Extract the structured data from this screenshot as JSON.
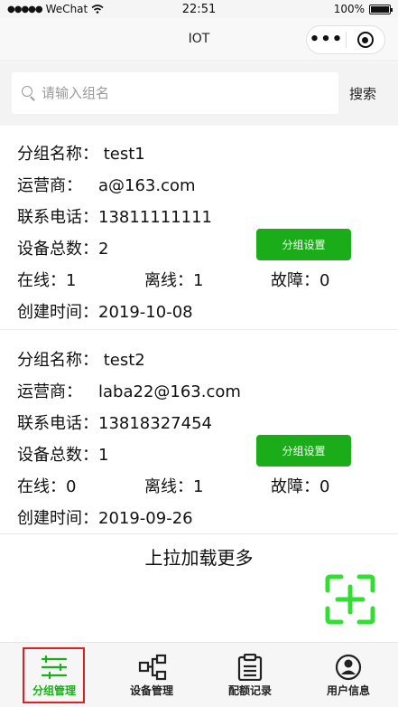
{
  "statusbar": {
    "carrier": "WeChat",
    "time": "22:51",
    "battery": "100%",
    "battery_level": 1.0
  },
  "navbar": {
    "title": "IOT"
  },
  "search": {
    "placeholder": "请输入组名",
    "button_label": "搜索"
  },
  "groups": [
    {
      "name_label": "分组名称：",
      "name": "test1",
      "operator_label": "运营商：",
      "operator": "a@163.com",
      "phone_label": "联系电话：",
      "phone": "13811111111",
      "total_label": "设备总数：",
      "total": "2",
      "online_label": "在线：",
      "online": "1",
      "offline_label": "离线：",
      "offline": "1",
      "fault_label": "故障：",
      "fault": "0",
      "created_label": "创建时间：",
      "created": "2019-10-08",
      "settings_button": "分组设置"
    },
    {
      "name_label": "分组名称：",
      "name": "test2",
      "operator_label": "运营商：",
      "operator": "laba22@163.com",
      "phone_label": "联系电话：",
      "phone": "13818327454",
      "total_label": "设备总数：",
      "total": "1",
      "online_label": "在线：",
      "online": "0",
      "offline_label": "离线：",
      "offline": "1",
      "fault_label": "故障：",
      "fault": "0",
      "created_label": "创建时间：",
      "created": "2019-09-26",
      "settings_button": "分组设置"
    }
  ],
  "load_more": "上拉加载更多",
  "colors": {
    "accent": "#1aad19",
    "fab": "#33dd33",
    "highlight": "#e02020"
  },
  "tabbar": {
    "items": [
      {
        "label": "分组管理",
        "icon": "sliders-icon",
        "active": true
      },
      {
        "label": "设备管理",
        "icon": "device-tree-icon",
        "active": false
      },
      {
        "label": "配额记录",
        "icon": "clipboard-icon",
        "active": false
      },
      {
        "label": "用户信息",
        "icon": "user-circle-icon",
        "active": false
      }
    ]
  }
}
